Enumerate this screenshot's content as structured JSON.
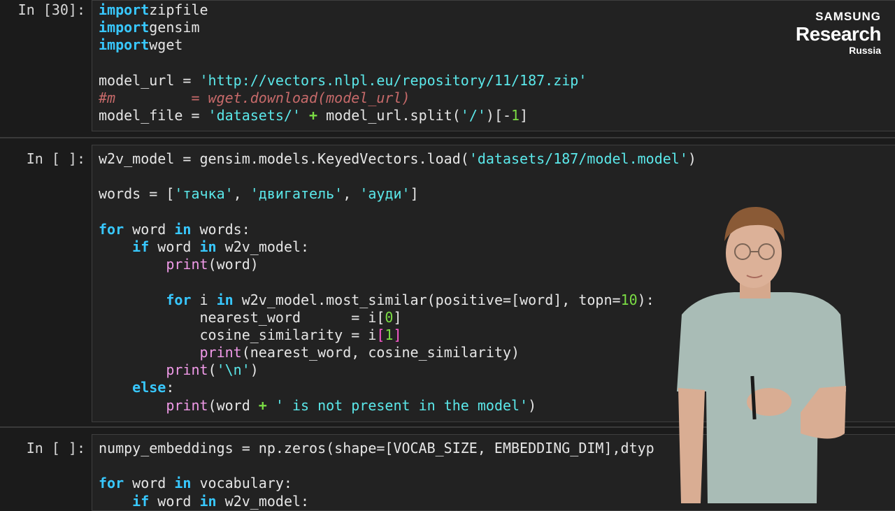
{
  "logo": {
    "line1": "SAMSUNG",
    "line2": "Research",
    "line3": "Russia"
  },
  "cells": [
    {
      "prompt": "In [30]:",
      "lines": [
        [
          [
            "kw",
            "import"
          ],
          [
            "",
            "zipfile"
          ]
        ],
        [
          [
            "kw",
            "import"
          ],
          [
            "",
            "gensim"
          ]
        ],
        [
          [
            "kw",
            "import"
          ],
          [
            "",
            "wget"
          ]
        ],
        [],
        [
          [
            "",
            "model_url = "
          ],
          [
            "str",
            "'http://vectors.nlpl.eu/repository/11/187.zip'"
          ]
        ],
        [
          [
            "cmt",
            "#m         = wget.download(model_url)"
          ]
        ],
        [
          [
            "",
            "model_file = "
          ],
          [
            "str",
            "'datasets/'"
          ],
          [
            "op",
            "+"
          ],
          [
            "",
            "model_url.split("
          ],
          [
            "str",
            "'/'"
          ],
          [
            "",
            ")[-"
          ],
          [
            "num",
            "1"
          ],
          [
            "",
            "]"
          ]
        ]
      ]
    },
    {
      "prompt": "In [ ]:",
      "lines": [
        [
          [
            "",
            "w2v_model = gensim.models.KeyedVectors.load("
          ],
          [
            "str",
            "'datasets/187/model.model'"
          ],
          [
            "",
            ")"
          ]
        ],
        [],
        [
          [
            "",
            "words = ["
          ],
          [
            "str",
            "'тачка'"
          ],
          [
            "",
            ", "
          ],
          [
            "str",
            "'двигатель'"
          ],
          [
            "",
            ", "
          ],
          [
            "str",
            "'ауди'"
          ],
          [
            "",
            "]"
          ]
        ],
        [],
        [
          [
            "kw",
            "for"
          ],
          [
            "",
            " word "
          ],
          [
            "kw",
            "in"
          ],
          [
            "",
            " words:"
          ]
        ],
        [
          [
            "",
            "    "
          ],
          [
            "kw",
            "if"
          ],
          [
            "",
            " word "
          ],
          [
            "kw",
            "in"
          ],
          [
            "",
            " w2v_model:"
          ]
        ],
        [
          [
            "",
            "        "
          ],
          [
            "bi",
            "print"
          ],
          [
            "",
            "(word)"
          ]
        ],
        [],
        [
          [
            "",
            "        "
          ],
          [
            "kw",
            "for"
          ],
          [
            "",
            " i "
          ],
          [
            "kw",
            "in"
          ],
          [
            "",
            " w2v_model.most_similar(positive=[word], topn="
          ],
          [
            "num",
            "10"
          ],
          [
            "",
            "):"
          ]
        ],
        [
          [
            "",
            "            nearest_word      = i["
          ],
          [
            "num",
            "0"
          ],
          [
            "",
            "]"
          ]
        ],
        [
          [
            "",
            "            cosine_similarity = i"
          ],
          [
            "br",
            "["
          ],
          [
            "num",
            "1"
          ],
          [
            "br",
            "]"
          ]
        ],
        [
          [
            "",
            "            "
          ],
          [
            "bi",
            "print"
          ],
          [
            "",
            "(nearest_word, cosine_similarity)"
          ]
        ],
        [
          [
            "",
            "        "
          ],
          [
            "bi",
            "print"
          ],
          [
            "",
            "("
          ],
          [
            "str",
            "'\\n'"
          ],
          [
            "",
            ")"
          ]
        ],
        [
          [
            "",
            "    "
          ],
          [
            "kw",
            "else"
          ],
          [
            "",
            ":"
          ]
        ],
        [
          [
            "",
            "        "
          ],
          [
            "bi",
            "print"
          ],
          [
            "",
            "(word "
          ],
          [
            "op",
            "+"
          ],
          [
            "",
            " "
          ],
          [
            "str",
            "' is not present in the model'"
          ],
          [
            "",
            ")"
          ]
        ]
      ]
    },
    {
      "prompt": "In [ ]:",
      "lines": [
        [
          [
            "",
            "numpy_embeddings = np.zeros(shape=[VOCAB_SIZE, EMBEDDING_DIM],dtyp"
          ]
        ],
        [],
        [
          [
            "kw",
            "for"
          ],
          [
            "",
            " word "
          ],
          [
            "kw",
            "in"
          ],
          [
            "",
            " vocabulary:"
          ]
        ],
        [
          [
            "",
            "    "
          ],
          [
            "kw",
            "if"
          ],
          [
            "",
            " word "
          ],
          [
            "kw",
            "in"
          ],
          [
            "",
            " w2v_model:"
          ]
        ]
      ]
    }
  ],
  "colors": {
    "background": "#1b1b1b",
    "keyword": "#38c8ff",
    "string": "#5be8ea",
    "comment": "#c76a6a",
    "operator": "#7bdd44",
    "builtin": "#f09ae8"
  },
  "presenter": {
    "description_icon": "presenter-figure"
  }
}
